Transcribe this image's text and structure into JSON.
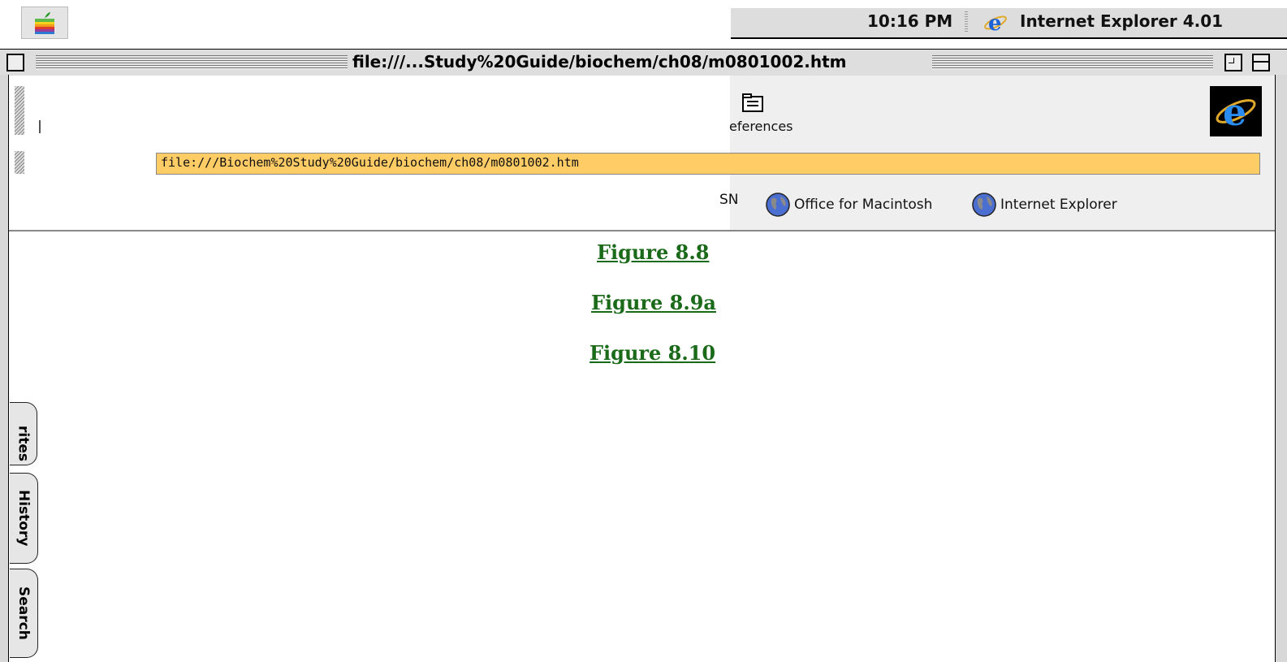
{
  "menubar": {
    "clock": "10:16 PM",
    "app_name": "Internet Explorer 4.01",
    "apple_icon": "apple-menu-icon",
    "app_icon": "internet-explorer-icon"
  },
  "window": {
    "title": "file:///...Study%20Guide/biochem/ch08/m0801002.htm"
  },
  "toolbar": {
    "preferences_label": "eferences",
    "preferences_icon": "preferences-icon",
    "throbber_icon": "ie-logo-icon"
  },
  "address": {
    "value": "file:///Biochem%20Study%20Guide/biochem/ch08/m0801002.htm"
  },
  "favorites_bar": {
    "items": [
      {
        "label": "SN"
      },
      {
        "label": "Office for Macintosh",
        "icon": "globe-icon"
      },
      {
        "label": "Internet Explorer",
        "icon": "globe-icon"
      }
    ]
  },
  "content": {
    "links": [
      {
        "label": "Figure 8.8"
      },
      {
        "label": "Figure 8.9a"
      },
      {
        "label": "Figure 8.10"
      }
    ]
  },
  "sidebar": {
    "tabs": [
      {
        "label": "rites"
      },
      {
        "label": "History"
      },
      {
        "label": "Search"
      }
    ]
  },
  "colors": {
    "address_bg": "#ffcc66",
    "link": "#1a6a1a"
  }
}
